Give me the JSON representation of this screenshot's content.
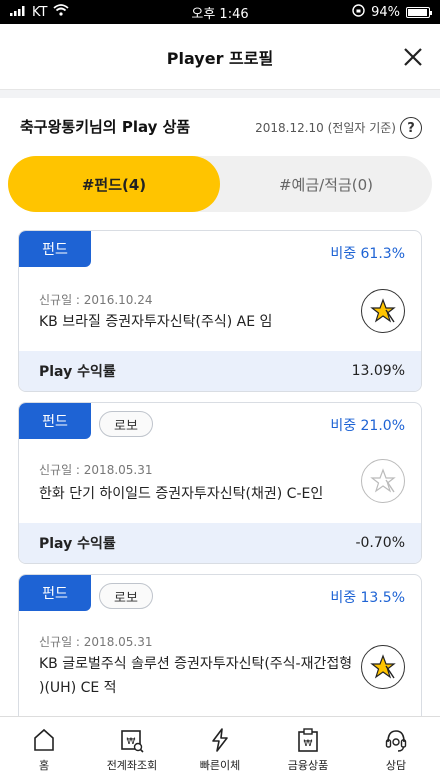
{
  "status_bar": {
    "carrier": "KT",
    "time": "오후 1:46",
    "battery": "94%",
    "battery_level": 0.94
  },
  "header": {
    "title": "Player 프로필"
  },
  "products": {
    "title": "축구왕통키님의 Play 상품",
    "date": "2018.12.10 (전일자 기준)",
    "help": "?"
  },
  "tabs": [
    {
      "label": "#펀드(4)",
      "active": true
    },
    {
      "label": "#예금/적금(0)",
      "active": false
    }
  ],
  "cards": [
    {
      "badge": "펀드",
      "robo": "",
      "weight": "비중 61.3%",
      "date": "신규일 : 2016.10.24",
      "name": "KB 브라질 증권자투자신탁(주식) AE 임",
      "starred": true,
      "yield_label": "Play 수익률",
      "yield_value": "13.09%"
    },
    {
      "badge": "펀드",
      "robo": "로보",
      "weight": "비중 21.0%",
      "date": "신규일 : 2018.05.31",
      "name": "한화 단기 하이일드 증권자투자신탁(채권) C-E인",
      "starred": false,
      "yield_label": "Play 수익률",
      "yield_value": "-0.70%"
    },
    {
      "badge": "펀드",
      "robo": "로보",
      "weight": "비중 13.5%",
      "date": "신규일 : 2018.05.31",
      "name_line1": "KB 글로벌주식 솔루션 증권자투자신탁(주식-재간접형",
      "name_line2": ")(UH) CE 적",
      "starred": true
    }
  ],
  "tabbar": [
    {
      "label": "홈",
      "icon": "home-icon"
    },
    {
      "label": "전계좌조회",
      "icon": "account-search-icon"
    },
    {
      "label": "빠른이체",
      "icon": "lightning-icon"
    },
    {
      "label": "금융상품",
      "icon": "financial-product-icon"
    },
    {
      "label": "상담",
      "icon": "headset-icon"
    }
  ],
  "colors": {
    "accent": "#ffc400",
    "brand_blue": "#1e63d4"
  }
}
